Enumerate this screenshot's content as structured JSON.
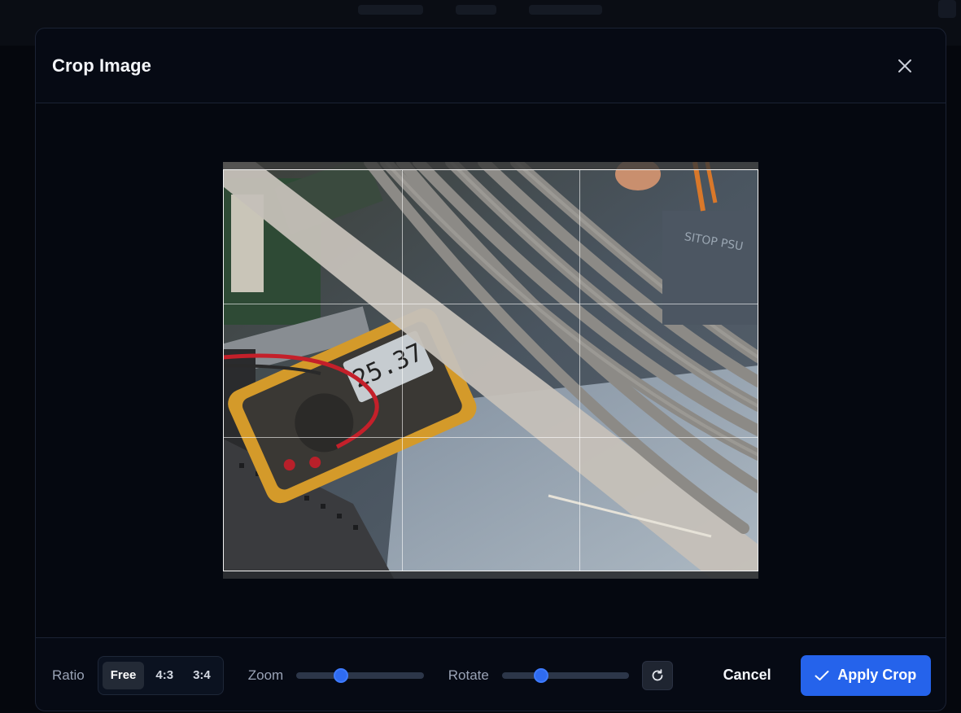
{
  "dialog": {
    "title": "Crop Image",
    "close_icon": "close-icon"
  },
  "toolbar": {
    "ratio_label": "Ratio",
    "ratio_options": [
      "Free",
      "4:3",
      "3:4"
    ],
    "ratio_selected": "Free",
    "zoom_label": "Zoom",
    "zoom_level": 0.33,
    "rotate_label": "Rotate",
    "rotate_level": 0.28,
    "reset_icon": "rotate-reset-icon",
    "cancel_label": "Cancel",
    "apply_label": "Apply Crop",
    "apply_icon": "check-icon"
  },
  "colors": {
    "accent": "#2563eb",
    "background": "#060a14",
    "meter_body": "#d49a2a"
  }
}
